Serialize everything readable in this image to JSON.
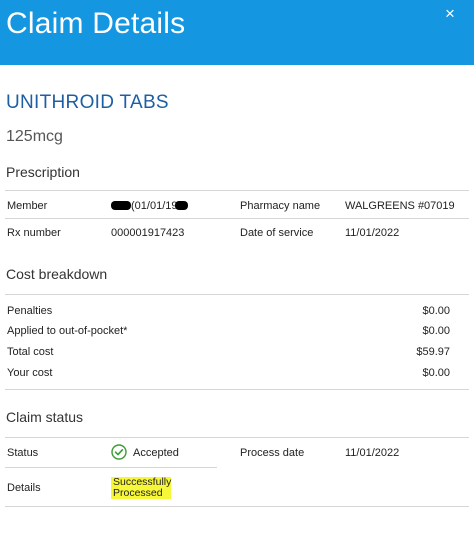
{
  "header": {
    "title": "Claim Details",
    "close_icon": "×"
  },
  "drug": {
    "name": "UNITHROID TABS",
    "strength": "125mcg"
  },
  "prescription": {
    "title": "Prescription",
    "member_label": "Member",
    "member_dob_text": "(01/01/19",
    "pharmacy_label": "Pharmacy name",
    "pharmacy_value": "WALGREENS #07019",
    "rx_label": "Rx number",
    "rx_value": "000001917423",
    "date_label": "Date of service",
    "date_value": "11/01/2022"
  },
  "cost": {
    "title": "Cost breakdown",
    "rows": [
      {
        "label": "Penalties",
        "value": "$0.00"
      },
      {
        "label": "Applied to out-of-pocket*",
        "value": "$0.00"
      },
      {
        "label": "Total cost",
        "value": "$59.97"
      },
      {
        "label": "Your cost",
        "value": "$0.00"
      }
    ]
  },
  "claim": {
    "title": "Claim status",
    "status_label": "Status",
    "status_value": "Accepted",
    "process_label": "Process date",
    "process_value": "11/01/2022",
    "details_label": "Details",
    "details_line1": "Successfully",
    "details_line2": "Processed"
  },
  "colors": {
    "header": "#1496e1",
    "accent": "#1c5fa3",
    "success": "#3a9b35",
    "highlight": "#f7f73a"
  }
}
